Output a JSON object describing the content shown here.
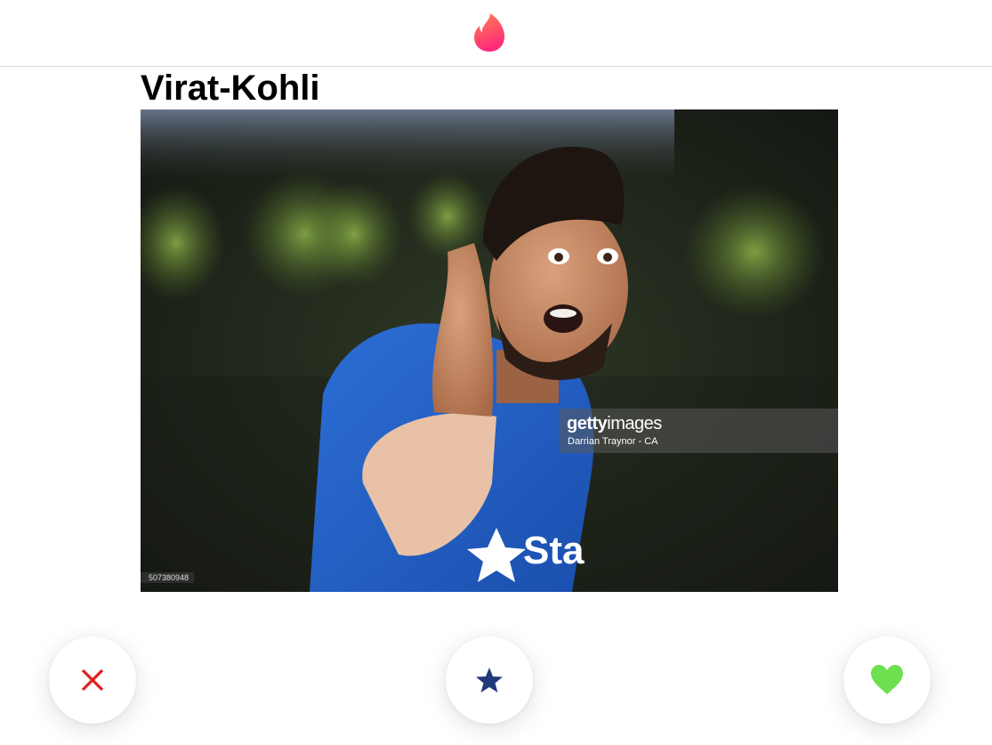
{
  "header": {
    "logo_icon": "flame-icon",
    "logo_gradient": [
      "#fd297b",
      "#ff5864",
      "#ff655b"
    ]
  },
  "card": {
    "name": "Virat-Kohli",
    "photo": {
      "watermark_brand_bold": "getty",
      "watermark_brand_light": "images",
      "watermark_credit": "Darrian Traynor - CA",
      "image_id": "507380948"
    }
  },
  "actions": {
    "nope": {
      "icon": "close-icon",
      "color": "#e02020"
    },
    "super_like": {
      "icon": "star-icon",
      "color": "#1f3a7a"
    },
    "like": {
      "icon": "heart-icon",
      "color": "#6ee04f"
    }
  }
}
